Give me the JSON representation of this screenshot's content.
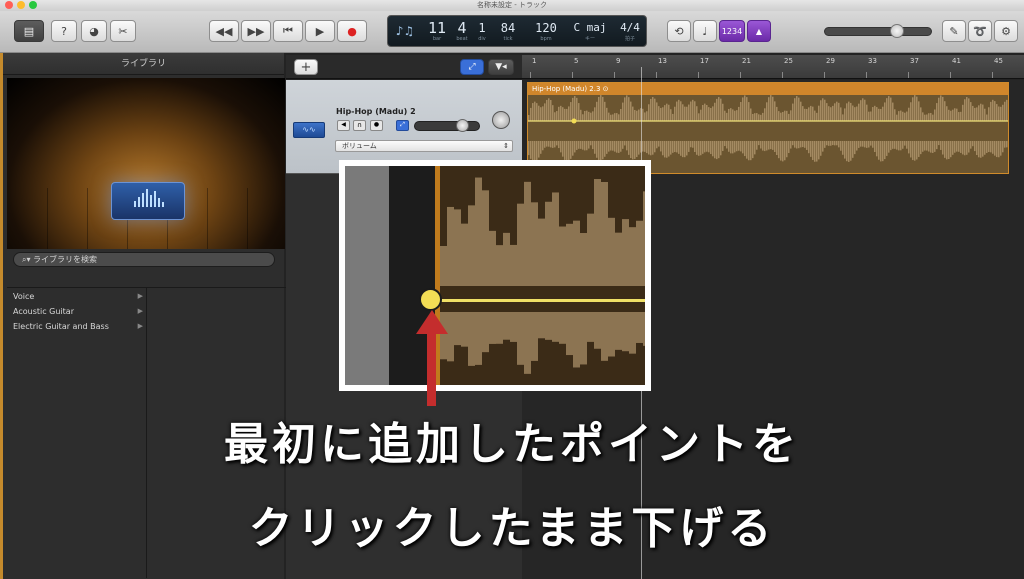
{
  "window": {
    "title": "名称未設定 - トラック",
    "traffic_colors": [
      "#ff5f57",
      "#febc2e",
      "#28c840"
    ]
  },
  "toolbar": {
    "left_icons": [
      "library-icon",
      "help-icon",
      "smart-controls-icon",
      "editors-icon"
    ],
    "transport_icons": [
      "rewind-icon",
      "fast-forward-icon",
      "go-to-beginning-icon",
      "play-icon",
      "record-icon"
    ],
    "right_icons": [
      "cycle-icon",
      "tuner-icon",
      "count-in-icon",
      "metronome-icon"
    ],
    "count_in_label": "1234",
    "far_right_icons": [
      "notepad-icon",
      "apple-loops-icon",
      "media-browser-icon"
    ]
  },
  "lcd": {
    "bar": "11",
    "beat": "4",
    "division": "1",
    "tick": "84",
    "tempo": "120",
    "key": "C maj",
    "signature": "4/4",
    "captions": {
      "bar": "bar",
      "beat": "beat",
      "division": "div",
      "tick": "tick",
      "tempo": "bpm",
      "key": "キー",
      "signature": "拍子"
    }
  },
  "library": {
    "title": "ライブラリ",
    "search_placeholder": "ライブラリを検索",
    "items": [
      {
        "label": "Voice"
      },
      {
        "label": "Acoustic Guitar"
      },
      {
        "label": "Electric Guitar and Bass"
      }
    ]
  },
  "tracks": {
    "add_label": "+",
    "track_name": "Hip-Hop (Madu) 2",
    "automation_label": "ボリューム",
    "region_name": "Hip-Hop (Madu) 2.3"
  },
  "ruler": {
    "marks": [
      "1",
      "5",
      "9",
      "13",
      "17",
      "21",
      "25",
      "29",
      "33",
      "37",
      "41",
      "45"
    ]
  },
  "caption": {
    "line1": "最初に追加したポイントを",
    "line2": "クリックしたまま下げる"
  },
  "colors": {
    "region": "#d0862b",
    "automation_point": "#f3dd55",
    "arrow": "#c42d2d",
    "purple_button": "#7a3fbf"
  }
}
